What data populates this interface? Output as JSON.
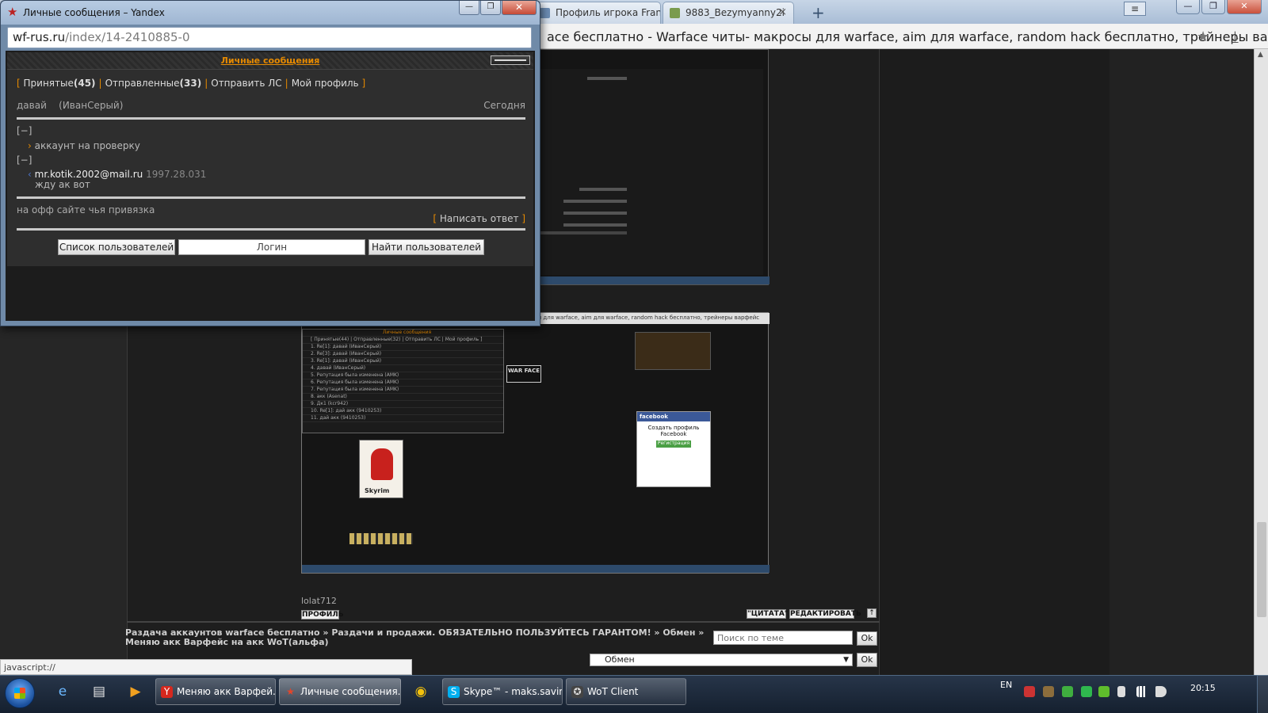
{
  "bg_browser": {
    "tabs": [
      {
        "label": "Профиль игрока Fran"
      },
      {
        "label": "9883_Bezymyanny2i"
      }
    ],
    "page_title": "ace бесплатно - Warface читы- макросы для warface, aim для warface, random hack бесплатно, трейнеры варф..."
  },
  "popup": {
    "window_title": "Личные сообщения – Yandex",
    "url_host": "wf-rus.ru",
    "url_path": "/index/14-2410885-0",
    "header_title": "Личные сообщения",
    "nav": {
      "inbox_label": "Принятые",
      "inbox_count": "(45)",
      "sent_label": "Отправленные",
      "sent_count": "(33)",
      "send_pm": "Отправить ЛС",
      "my_profile": "Мой профиль"
    },
    "subject": "давай",
    "sender": "(ИванСерый)",
    "date": "Сегодня",
    "toggle1": "[−]",
    "msg1": "аккаунт на проверку",
    "toggle2": "[−]",
    "msg2_email": "mr.kotik.2002@mail.ru",
    "msg2_meta": "1997.28.031",
    "msg2_body": "жду ак вот",
    "bottom_text": "на офф сайте чья привязка",
    "reply_label": "Написать ответ",
    "users_list_btn": "Список пользователей",
    "login_placeholder": "Логин",
    "find_users_btn": "Найти пользователей"
  },
  "forum": {
    "user_name": "lolat712",
    "profile_btn": "ПРОФИЛЬ",
    "quote_btn": "\"ЦИТАТА\"",
    "edit_btn": "РЕДАКТИРОВАТЬ",
    "breadcrumbs": "Раздача аккаунтов warface бесплатно » Раздачи и продажи. ОБЯЗАТЕЛЬНО ПОЛЬЗУЙТЕСЬ ГАРАНТОМ! » Обмен » Меняю акк Варфейс на акк WoT(альфа)",
    "search_placeholder": "Поиск по теме",
    "ok_label": "Ok",
    "category_select": "Обмен"
  },
  "embedded_shot": {
    "facebook_head": "facebook",
    "facebook_title": "Создать профиль Facebook",
    "facebook_btn": "Регистрация",
    "santa_caption": "Skyrim",
    "warface_logo": "WAR FACE"
  },
  "status_bar": {
    "text": "javascript://"
  },
  "taskbar": {
    "tasks": [
      {
        "label": "Меняю акк Варфей..."
      },
      {
        "label": "Личные сообщения..."
      },
      {
        "label": "Skype™ - maks.savin..."
      },
      {
        "label": "WoT Client"
      }
    ],
    "lang": "EN",
    "clock": "20:15"
  },
  "colors": {
    "accent_orange": "#e68a00",
    "skype_blue": "#00aff0",
    "yandex_red": "#d6281e"
  }
}
